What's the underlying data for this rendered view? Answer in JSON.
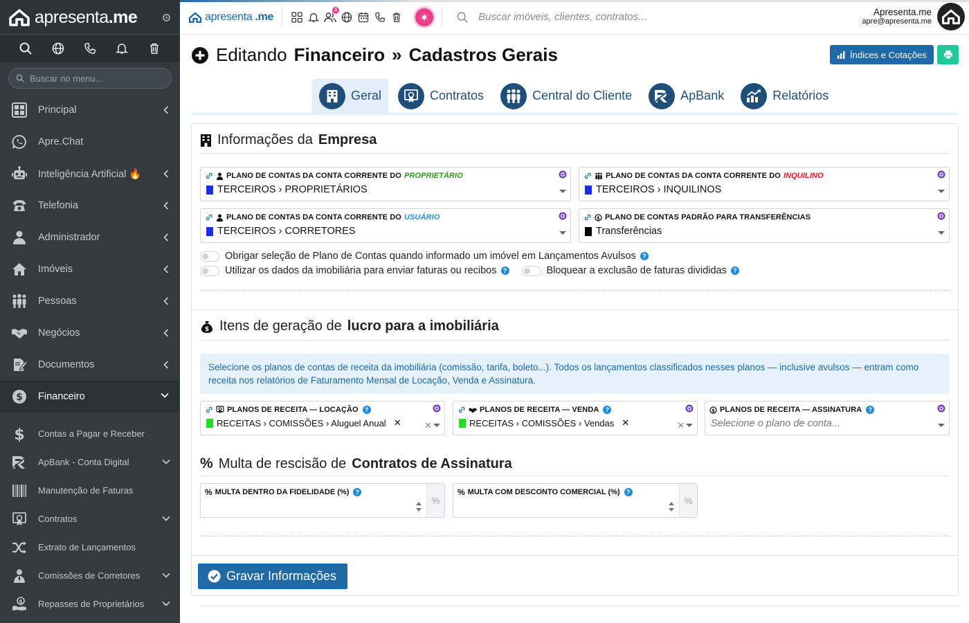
{
  "sidebar": {
    "logo_text_light": "apresenta",
    "logo_text_bold": ".me",
    "search_placeholder": "Buscar no menu...",
    "top_icons": [
      "search-icon",
      "globe-icon",
      "phone-icon",
      "bell-icon",
      "trash-icon"
    ],
    "menu": [
      {
        "label": "Principal",
        "icon": "dashboard-icon",
        "chevron": true
      },
      {
        "label": "Apre.Chat",
        "icon": "whatsapp-icon",
        "chevron": false
      },
      {
        "label": "Inteligência Artificial 🔥",
        "icon": "robot-icon",
        "chevron": true
      },
      {
        "label": "Telefonia",
        "icon": "telephone-icon",
        "chevron": true
      },
      {
        "label": "Administrador",
        "icon": "admin-user-icon",
        "chevron": true
      },
      {
        "label": "Imóveis",
        "icon": "home-icon",
        "chevron": true
      },
      {
        "label": "Pessoas",
        "icon": "people-icon",
        "chevron": true
      },
      {
        "label": "Negócios",
        "icon": "handshake-icon",
        "chevron": true
      },
      {
        "label": "Documentos",
        "icon": "document-edit-icon",
        "chevron": true
      },
      {
        "label": "Financeiro",
        "icon": "dollar-circle-icon",
        "chevron": true,
        "active": true
      }
    ],
    "submenu": [
      {
        "label": "Contas a Pagar e Receber",
        "icon": "dollar-icon",
        "chevron": false
      },
      {
        "label": "ApBank - Conta Digital",
        "icon": "apbank-icon",
        "chevron": true
      },
      {
        "label": "Manutenção de Faturas",
        "icon": "barcode-icon",
        "chevron": false
      },
      {
        "label": "Contratos",
        "icon": "contract-icon",
        "chevron": true
      },
      {
        "label": "Extrato de Lançamentos",
        "icon": "shuffle-icon",
        "chevron": false
      },
      {
        "label": "Comissões de Corretores",
        "icon": "broker-icon",
        "chevron": true
      },
      {
        "label": "Repasses de Proprietários",
        "icon": "repasse-icon",
        "chevron": true
      }
    ]
  },
  "topbar": {
    "logo_light": "apresenta",
    "logo_bold": ".me",
    "notification_count": "4",
    "search_placeholder": "Buscar imóveis, clientes, contratos...",
    "user_name": "Apresenta.me",
    "user_email": "apre@apresenta.me"
  },
  "page": {
    "title_prefix": "Editando",
    "title_bold_1": "Financeiro",
    "title_sep": "»",
    "title_bold_2": "Cadastros Gerais",
    "btn_indices": "Índices e Cotações"
  },
  "tabs": [
    {
      "label": "Geral",
      "icon": "building-icon",
      "active": true
    },
    {
      "label": "Contratos",
      "icon": "certificate-icon",
      "active": false
    },
    {
      "label": "Central do Cliente",
      "icon": "clients-icon",
      "active": false
    },
    {
      "label": "ApBank",
      "icon": "apbank-logo-icon",
      "active": false
    },
    {
      "label": "Relatórios",
      "icon": "chart-icon",
      "active": false
    }
  ],
  "section_empresa": {
    "title_light": "Informações da",
    "title_bold": "Empresa",
    "fields": [
      {
        "label": "PLANO DE CONTAS DA CONTA CORRENTE DO",
        "label_em": "PROPRIETÁRIO",
        "em_color": "#2e9c1f",
        "value": "TERCEIROS › PROPRIETÁRIOS",
        "swatch": "#1a2ee8"
      },
      {
        "label": "PLANO DE CONTAS DA CONTA CORRENTE DO",
        "label_em": "INQUILINO",
        "em_color": "#e8141e",
        "value": "TERCEIROS › INQUILINOS",
        "swatch": "#1a2ee8"
      },
      {
        "label": "PLANO DE CONTAS DA CONTA CORRENTE DO",
        "label_em": "USUÁRIO",
        "em_color": "#2a8fd8",
        "value": "TERCEIROS › CORRETORES",
        "swatch": "#1a2ee8"
      },
      {
        "label": "PLANO DE CONTAS PADRÃO PARA TRANSFERÊNCIAS",
        "label_em": "",
        "em_color": "#111111",
        "value": "Transferências",
        "swatch": "#000000"
      }
    ],
    "toggle_1": "Obrigar seleção de Plano de Contas quando informado um imóvel em Lançamentos Avulsos",
    "toggle_2": "Utilizar os dados da imobiliária para enviar faturas ou recibos",
    "toggle_3": "Bloquear a exclusão de faturas divididas"
  },
  "section_lucro": {
    "title_light": "Itens de geração de",
    "title_bold": "lucro para a imobiliária",
    "info": "Selecione os planos de contas de receita da imobiliária (comissão, tarifa, boleto...). Todos os lançamentos classificados nesses planos — inclusive avulsos — entram como receita nos relatórios de Faturamento Mensal de Locação, Venda e Assinatura.",
    "fields": [
      {
        "label": "PLANOS DE RECEITA — LOCAÇÃO",
        "tag": "RECEITAS › COMISSÕES › Aluguel Anual",
        "swatch": "#22dd22"
      },
      {
        "label": "PLANOS DE RECEITA — VENDA",
        "tag": "RECEITAS › COMISSÕES › Vendas",
        "swatch": "#22dd22"
      },
      {
        "label": "PLANOS DE RECEITA — ASSINATURA",
        "placeholder": "Selecione o plano de conta..."
      }
    ]
  },
  "section_multa": {
    "title_light": "Multa de rescisão de",
    "title_bold": "Contratos de Assinatura",
    "fields": [
      {
        "label": "MULTA DENTRO DA FIDELIDADE (%)",
        "value": "",
        "unit": "%"
      },
      {
        "label": "MULTA COM DESCONTO COMERCIAL (%)",
        "value": "",
        "unit": "%"
      }
    ]
  },
  "save_button": "Gravar Informações",
  "colors": {
    "sidebar_bg": "#343a40",
    "primary": "#1f6aa6",
    "teal": "#20c997",
    "pink": "#e83e8c"
  }
}
